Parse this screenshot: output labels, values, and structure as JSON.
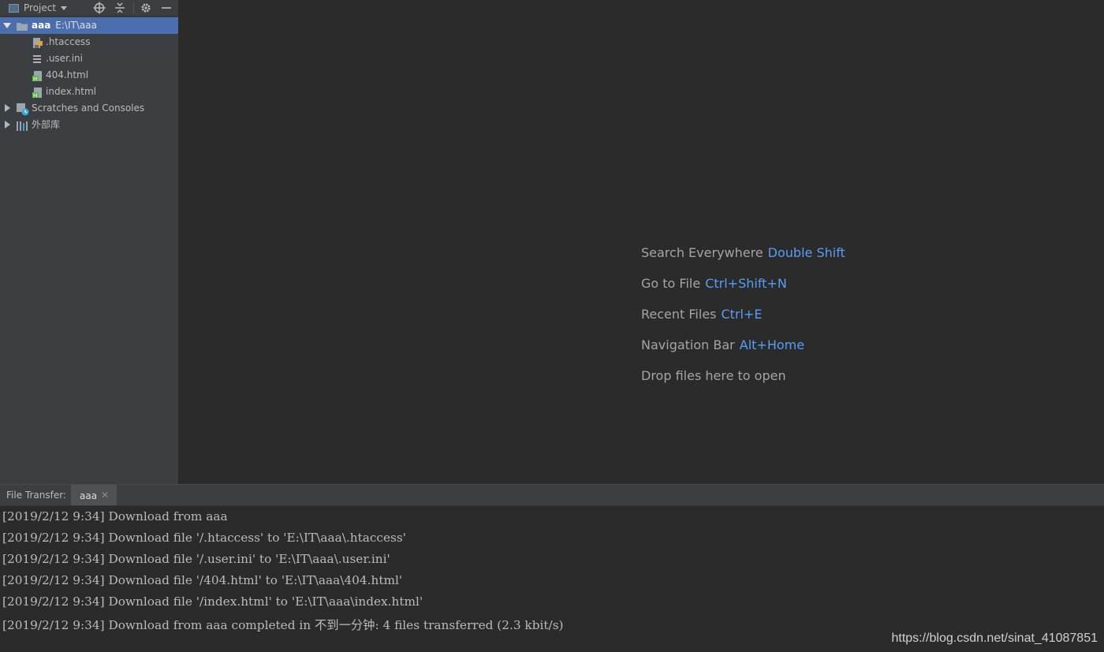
{
  "project_panel": {
    "title": "Project",
    "tree": [
      {
        "type": "root",
        "name": "aaa",
        "path": "E:\\IT\\aaa"
      },
      {
        "type": "file",
        "name": ".htaccess",
        "icon": "htaccess-file-icon"
      },
      {
        "type": "file",
        "name": ".user.ini",
        "icon": "ini-file-icon"
      },
      {
        "type": "file",
        "name": "404.html",
        "icon": "html-file-icon"
      },
      {
        "type": "file",
        "name": "index.html",
        "icon": "html-file-icon"
      },
      {
        "type": "node",
        "name": "Scratches and Consoles",
        "icon": "scratches-icon"
      },
      {
        "type": "node",
        "name": "外部库",
        "icon": "library-icon"
      }
    ]
  },
  "editor": {
    "hints": [
      {
        "label": "Search Everywhere",
        "shortcut": "Double Shift"
      },
      {
        "label": "Go to File",
        "shortcut": "Ctrl+Shift+N"
      },
      {
        "label": "Recent Files",
        "shortcut": "Ctrl+E"
      },
      {
        "label": "Navigation Bar",
        "shortcut": "Alt+Home"
      },
      {
        "label": "Drop files here to open",
        "shortcut": ""
      }
    ]
  },
  "bottom_panel": {
    "title": "File Transfer:",
    "tab_label": "aaa",
    "log": [
      "[2019/2/12 9:34] Download from aaa",
      "[2019/2/12 9:34] Download file '/.htaccess' to 'E:\\IT\\aaa\\.htaccess'",
      "[2019/2/12 9:34] Download file '/.user.ini' to 'E:\\IT\\aaa\\.user.ini'",
      "[2019/2/12 9:34] Download file '/404.html' to 'E:\\IT\\aaa\\404.html'",
      "[2019/2/12 9:34] Download file '/index.html' to 'E:\\IT\\aaa\\index.html'",
      "[2019/2/12 9:34] Download from aaa completed in 不到一分钟: 4 files transferred (2.3 kbit/s)"
    ]
  },
  "watermark": "https://blog.csdn.net/sinat_41087851",
  "colors": {
    "background": "#2b2b2b",
    "panel": "#3c3f41",
    "selection": "#4b6eaf",
    "shortcut": "#589df6"
  }
}
